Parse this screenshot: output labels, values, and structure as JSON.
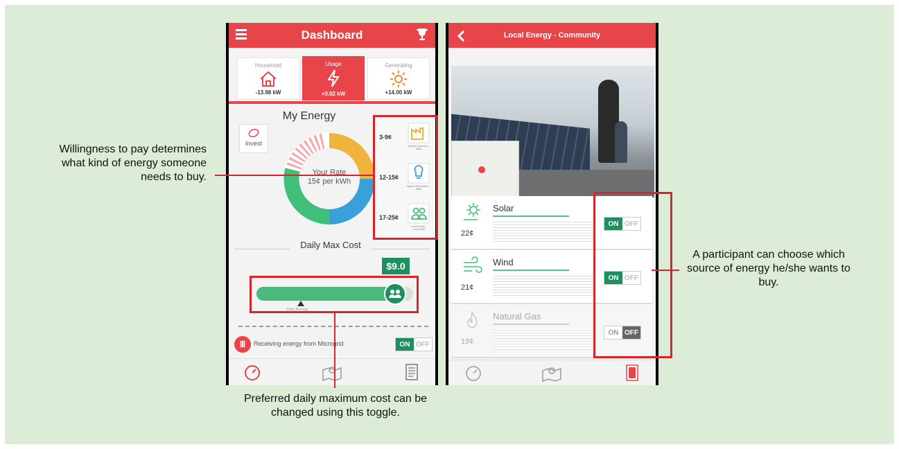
{
  "left_phone": {
    "header_title": "Dashboard",
    "tabs": [
      {
        "label": "Household",
        "value": "-13.98 kW",
        "icon": "house-icon"
      },
      {
        "label": "Usage",
        "value": "+0.02 kW",
        "icon": "lightning-icon"
      },
      {
        "label": "Generating",
        "value": "+14.00 kW",
        "icon": "sun-icon"
      }
    ],
    "my_energy_title": "My Energy",
    "invest_label": "Invest",
    "your_rate_label": "Your Rate",
    "rate_value": "15¢ per kWh",
    "price_tiers": [
      {
        "price": "3-9¢",
        "caption": "Highest Emissions - Utility"
      },
      {
        "price": "12-15¢",
        "caption": "Highest Renewables - Utility"
      },
      {
        "price": "17-25¢",
        "caption": "Local Energy - Community"
      }
    ],
    "daily_max_cost_title": "Daily Max Cost",
    "daily_max_value": "$9.0",
    "slider_caption": "Daily Average",
    "microgrid_label": "Receiving energy from Microgrid",
    "toggle_on": "ON",
    "toggle_off": "OFF"
  },
  "right_phone": {
    "header_title": "Local Energy - Community",
    "sources": [
      {
        "name": "Solar",
        "price": "22¢",
        "state": "ON"
      },
      {
        "name": "Wind",
        "price": "21¢",
        "state": "ON"
      },
      {
        "name": "Natural Gas",
        "price": "19¢",
        "state": "OFF"
      }
    ],
    "toggle_on": "ON",
    "toggle_off": "OFF"
  },
  "callouts": {
    "willingness": "Willingness to pay determines what kind of energy someone needs to buy.",
    "daily_cost": "Preferred daily maximum cost can be changed using this toggle.",
    "source_choice": "A participant can choose which source of energy he/she wants to buy."
  },
  "colors": {
    "header_red": "#e8454a",
    "accent_green": "#1f8f5f",
    "donut_yellow": "#f0b43c",
    "donut_blue": "#3aa0d8",
    "donut_green": "#3fbf7a",
    "callout_red": "#d7262b"
  }
}
